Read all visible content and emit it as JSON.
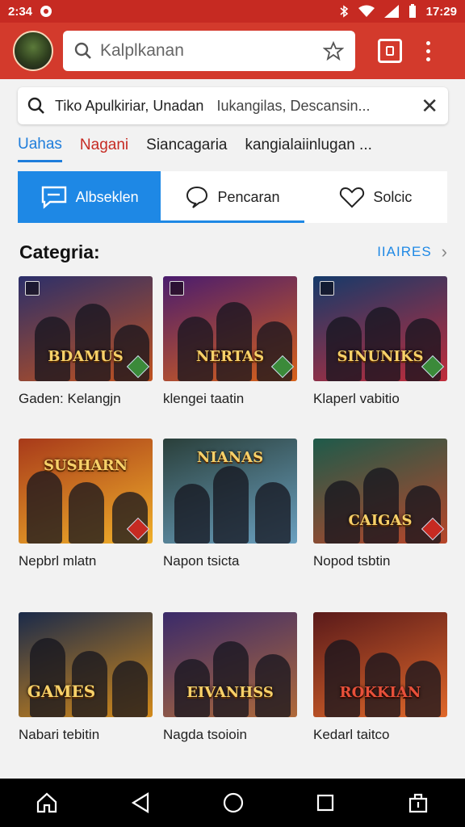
{
  "status": {
    "time_left": "2:34",
    "time_right": "17:29"
  },
  "header": {
    "search_placeholder": "Kalplkanan"
  },
  "search": {
    "query": "Tiko Apulkiriar, Unadan",
    "suggestion": "Iukangilas, Descansin..."
  },
  "tabs": [
    {
      "label": "Uahas"
    },
    {
      "label": "Nagani"
    },
    {
      "label": "Siancagaria"
    },
    {
      "label": "kangialaiinlugan ..."
    }
  ],
  "segments": [
    {
      "label": "Albseklen"
    },
    {
      "label": "Pencaran"
    },
    {
      "label": "Solcic"
    }
  ],
  "section": {
    "title": "Categria:",
    "more_label": "IIAIRES"
  },
  "cards": [
    {
      "logo": "BDAMUS",
      "label": "Gaden: Kelangjn",
      "colors": [
        "#2b2f6a",
        "#c0521f"
      ]
    },
    {
      "logo": "NERTAS",
      "label": "klengei taatin",
      "colors": [
        "#4a1c6e",
        "#d8621a"
      ]
    },
    {
      "logo": "SINUNIKS",
      "label": "Klaperl vabitio",
      "colors": [
        "#153a6a",
        "#c12c3a"
      ]
    },
    {
      "logo": "SUSHARN",
      "label": "Nepbrl mlatn",
      "colors": [
        "#a83a1a",
        "#f0b02a"
      ]
    },
    {
      "logo": "NIANAS",
      "label": "Napon tsicta",
      "colors": [
        "#2a3f3a",
        "#6aa0c0"
      ]
    },
    {
      "logo": "CAIGAS",
      "label": "Nopod tsbtin",
      "colors": [
        "#1e5a4a",
        "#b8462a"
      ]
    },
    {
      "logo": "GAMES",
      "label": "Nabari tebitin",
      "colors": [
        "#1a2a4a",
        "#d38a1a"
      ]
    },
    {
      "logo": "EIVANHSS",
      "label": "Nagda tsoioin",
      "colors": [
        "#3a2a6a",
        "#b06a3a"
      ]
    },
    {
      "logo": "ROKKIAN",
      "label": "Kedarl taitco",
      "colors": [
        "#5a1a1a",
        "#e0682a"
      ]
    }
  ],
  "colors": {
    "status_bar": "#c62a22",
    "app_bar": "#d33a2c",
    "accent": "#1e88e5"
  },
  "icons": [
    "search-icon",
    "bookmark-icon",
    "box-icon",
    "more-vert-icon",
    "clear-icon",
    "chat-icon",
    "comment-icon",
    "heart-icon",
    "chevron-right-icon",
    "home-icon",
    "back-icon",
    "home-circle-icon",
    "recents-icon",
    "share-icon"
  ]
}
